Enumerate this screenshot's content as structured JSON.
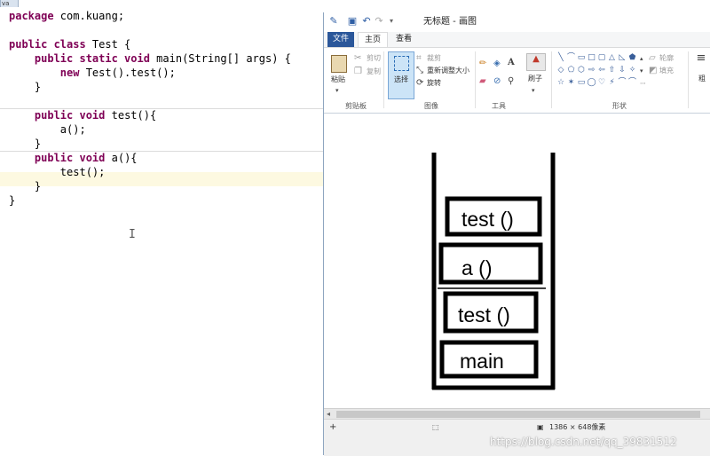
{
  "editor": {
    "tab_label": "va",
    "lines": {
      "l1_kw": "package",
      "l1_rest": " com.kuang;",
      "l2_kw": "public class",
      "l2_rest": " Test {",
      "l3_indent": "    ",
      "l3_kw": "public static void",
      "l3_rest": " main(String[] args) {",
      "l4_indent": "        ",
      "l4_kw": "new",
      "l4_rest": " Test().test();",
      "l5": "    }",
      "l6_indent": "    ",
      "l6_kw": "public void",
      "l6_rest": " test(){",
      "l7": "        a();",
      "l8": "    }",
      "l9_indent": "    ",
      "l9_kw": "public void",
      "l9_rest": " a(){",
      "l10": "        test();",
      "l11": "    }",
      "l12": "}"
    },
    "caret_glyph": "I"
  },
  "paint": {
    "title": "无标题 - 画图",
    "tabs": {
      "file": "文件",
      "home": "主页",
      "view": "查看"
    },
    "clipboard": {
      "paste": "粘贴",
      "cut": "剪切",
      "copy": "复制",
      "group": "剪贴板"
    },
    "image": {
      "select": "选择",
      "crop": "裁剪",
      "resize": "重新调整大小",
      "rotate": "旋转",
      "group": "图像"
    },
    "tools": {
      "group": "工具",
      "brush": "刷子"
    },
    "shapes": {
      "group": "形状",
      "outline": "轮廓",
      "fill": "填充",
      "glyphs": [
        "╲",
        "⌒",
        "▭",
        "□",
        "▢",
        "△",
        "◺",
        "⬟",
        "◇",
        "⬠",
        "⬡",
        "⇨",
        "⇦",
        "⇧",
        "⇩",
        "✧",
        "☆",
        "✶",
        "▭",
        "◯",
        "♡",
        "⚡",
        "⌒",
        "⌒"
      ]
    },
    "size_partial": "粗",
    "status": {
      "canvas_size": "1386 × 648像素"
    },
    "stack_frames": [
      "test ()",
      "a ()",
      "test ()",
      "main"
    ]
  },
  "watermark": "https://blog.csdn.net/qq_39831512"
}
